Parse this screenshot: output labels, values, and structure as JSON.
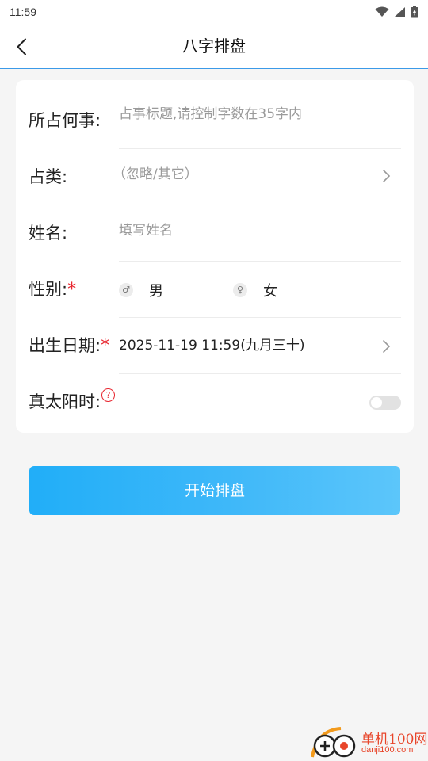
{
  "status_bar": {
    "time": "11:59",
    "icons": [
      "wifi-icon",
      "signal-icon",
      "battery-icon"
    ]
  },
  "nav": {
    "title": "八字排盘",
    "back_icon": "chevron-left-icon"
  },
  "form": {
    "matter": {
      "label": "所占何事:",
      "placeholder": "占事标题,请控制字数在35字内"
    },
    "category": {
      "label": "占类:",
      "placeholder": "（忽略/其它）"
    },
    "name": {
      "label": "姓名:",
      "placeholder": "填写姓名"
    },
    "gender": {
      "label": "性别:",
      "required_mark": "*",
      "options": [
        {
          "symbol": "♂",
          "label": "男"
        },
        {
          "symbol": "♀",
          "label": "女"
        }
      ]
    },
    "birth_date": {
      "label": "出生日期:",
      "required_mark": "*",
      "value": "2025-11-19 11:59(九月三十)"
    },
    "true_solar_time": {
      "label": "真太阳时:",
      "help": "?",
      "enabled": false
    }
  },
  "start_button": {
    "label": "开始排盘"
  },
  "watermark": {
    "cn": "单机100网",
    "en": "danji100.com"
  },
  "colors": {
    "accent": "#21aef8",
    "required": "#e8262f",
    "nav_divider": "#3b9ae8"
  }
}
